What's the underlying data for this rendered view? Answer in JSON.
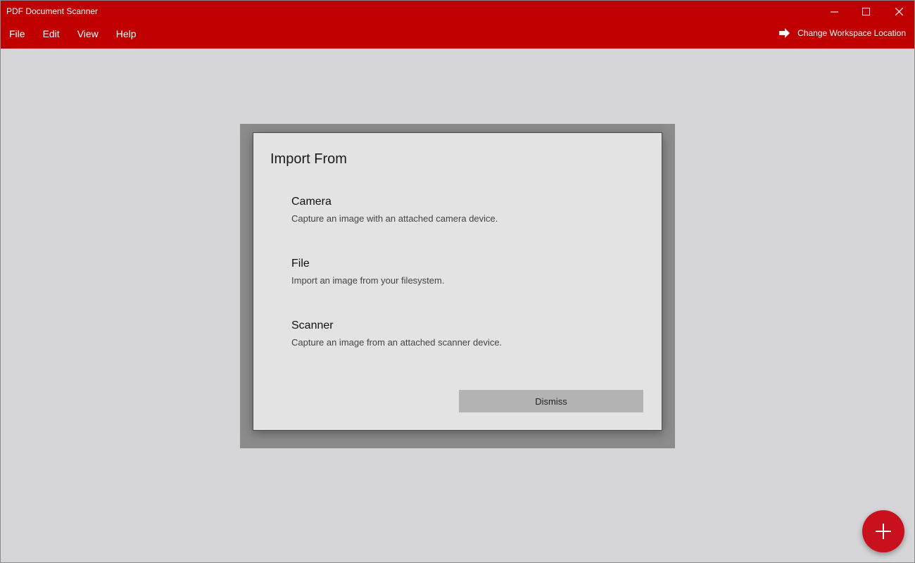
{
  "window": {
    "title": "PDF Document Scanner"
  },
  "menu": {
    "items": [
      "File",
      "Edit",
      "View",
      "Help"
    ]
  },
  "toolbar": {
    "workspace_label": "Change Workspace Location"
  },
  "dialog": {
    "title": "Import From",
    "options": [
      {
        "title": "Camera",
        "description": "Capture an image with an attached camera device."
      },
      {
        "title": "File",
        "description": "Import an image from your filesystem."
      },
      {
        "title": "Scanner",
        "description": "Capture an image from an attached scanner device."
      }
    ],
    "dismiss_label": "Dismiss"
  },
  "icons": {
    "workspace": "arrow-right-icon",
    "fab": "plus-icon"
  },
  "colors": {
    "accent": "#c00000",
    "fab": "#c8111c",
    "background": "#d6d6d9"
  }
}
